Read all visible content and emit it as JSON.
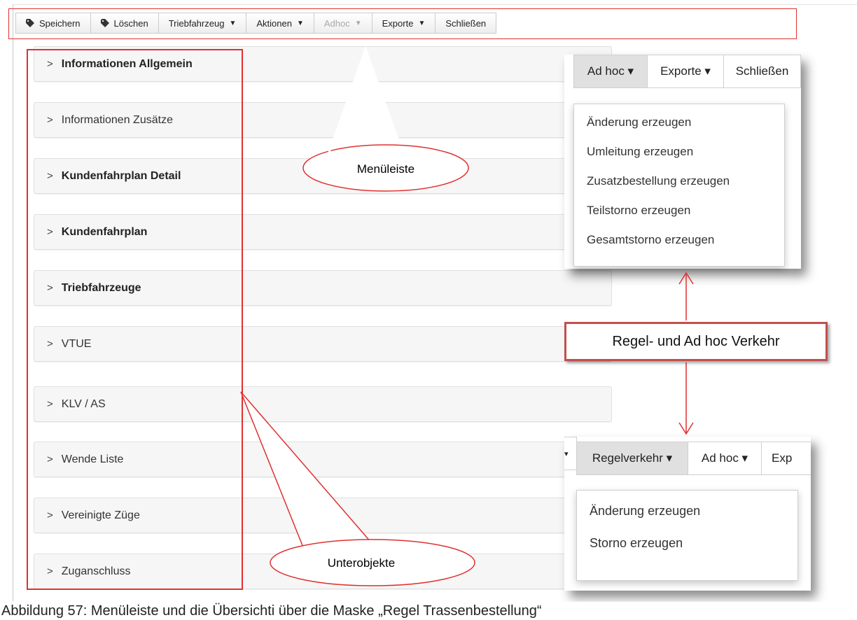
{
  "toolbar": {
    "buttons": [
      {
        "label": "Speichern",
        "icon": "tag-icon"
      },
      {
        "label": "Löschen",
        "icon": "tag-icon"
      },
      {
        "label": "Triebfahrzeug",
        "caret": "▼"
      },
      {
        "label": "Aktionen",
        "caret": "▼"
      },
      {
        "label": "Adhoc",
        "caret": "▼",
        "disabled": true
      },
      {
        "label": "Exporte",
        "caret": "▼"
      },
      {
        "label": "Schließen"
      }
    ]
  },
  "panels": [
    {
      "label": "Informationen Allgemein",
      "bold": true
    },
    {
      "label": "Informationen Zusätze",
      "bold": false
    },
    {
      "label": "Kundenfahrplan Detail",
      "bold": true
    },
    {
      "label": "Kundenfahrplan",
      "bold": true
    },
    {
      "label": "Triebfahrzeuge",
      "bold": true
    },
    {
      "label": "VTUE",
      "bold": false
    },
    {
      "label": "KLV / AS",
      "bold": false
    },
    {
      "label": "Wende Liste",
      "bold": false
    },
    {
      "label": "Vereinigte Züge",
      "bold": false
    },
    {
      "label": "Zuganschluss",
      "bold": false
    }
  ],
  "chevron": ">",
  "inset_adhoc": {
    "buttons": [
      "Ad hoc ▾",
      "Exporte ▾",
      "Schließen"
    ],
    "items": [
      "Änderung erzeugen",
      "Umleitung erzeugen",
      "Zusatzbestellung erzeugen",
      "Teilstorno erzeugen",
      "Gesamtstorno erzeugen"
    ]
  },
  "inset_regel": {
    "buttons": [
      "Regelverkehr ▾",
      "Ad hoc ▾",
      "Exp"
    ],
    "items": [
      "Änderung erzeugen",
      "Storno erzeugen"
    ]
  },
  "callouts": {
    "menu": "Menüleiste",
    "sub": "Unterobjekte",
    "traffic": "Regel- und Ad hoc Verkehr"
  },
  "caption": "Abbildung 57: Menüleiste und die Übersichti über die Maske „Regel Trassenbestellung“",
  "colors": {
    "annotation_red": "#e03030",
    "box_border": "#c0504d"
  }
}
